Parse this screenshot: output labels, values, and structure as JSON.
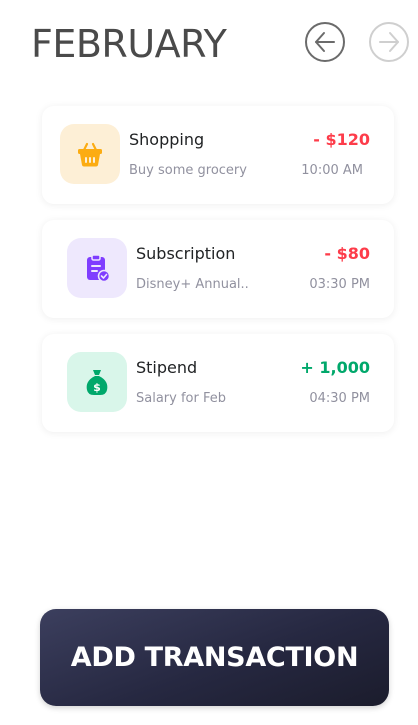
{
  "header": {
    "month": "FEBRUARY",
    "prev_icon": "arrow-left-icon",
    "next_icon": "arrow-right-icon"
  },
  "transactions": [
    {
      "title": "Shopping",
      "subtitle": "Buy some grocery",
      "amount": "- $120",
      "time": "10:00 AM",
      "type": "expense",
      "icon": "shopping-basket-icon",
      "icon_color": "#fcac12",
      "icon_bg": "#fdefd6"
    },
    {
      "title": "Subscription",
      "subtitle": "Disney+ Annual..",
      "amount": "- $80",
      "time": "03:30 PM",
      "type": "expense",
      "icon": "subscription-clipboard-icon",
      "icon_color": "#7f3dff",
      "icon_bg": "#eee8fd"
    },
    {
      "title": "Stipend",
      "subtitle": "Salary for Feb",
      "amount": "+ 1,000",
      "time": "04:30 PM",
      "type": "income",
      "icon": "money-bag-icon",
      "icon_color": "#00a86b",
      "icon_bg": "#d9f6ea"
    }
  ],
  "actions": {
    "add_label": "ADD TRANSACTION"
  },
  "colors": {
    "expense": "#fd3c4a",
    "income": "#00a86b",
    "button_dark": "#262841"
  }
}
